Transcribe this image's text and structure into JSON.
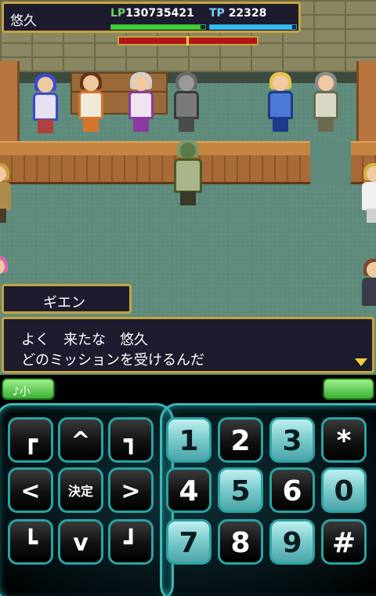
{
  "hud": {
    "player_name": "悠久",
    "hp_tag": "LP",
    "hp_value": "130735421",
    "hp_fill_fraction": 0.95,
    "tp_tag": "TP",
    "tp_value": "22328",
    "tp_fill_fraction": 0.95,
    "boss_gauge_fraction": 1.0
  },
  "dialog": {
    "speaker": "ギエン",
    "line1": "よく　来たな　悠久",
    "line2": "どのミッションを受けるんだ"
  },
  "softkeys": {
    "left_label": "♪小",
    "right_label": ""
  },
  "dpad": {
    "up_left": "┏",
    "up": "^",
    "up_right": "┓",
    "left": "<",
    "center": "決定",
    "right": ">",
    "down_left": "┗",
    "down": "v",
    "down_right": "┛"
  },
  "numpad": [
    "1",
    "2",
    "3",
    "*",
    "4",
    "5",
    "6",
    "0",
    "7",
    "8",
    "9",
    "#"
  ],
  "colors": {
    "frame_gold": "#c7a33e",
    "keypad_teal": "#3db7b7",
    "hp_green": "#3fd23a",
    "tp_blue": "#33bff2"
  }
}
